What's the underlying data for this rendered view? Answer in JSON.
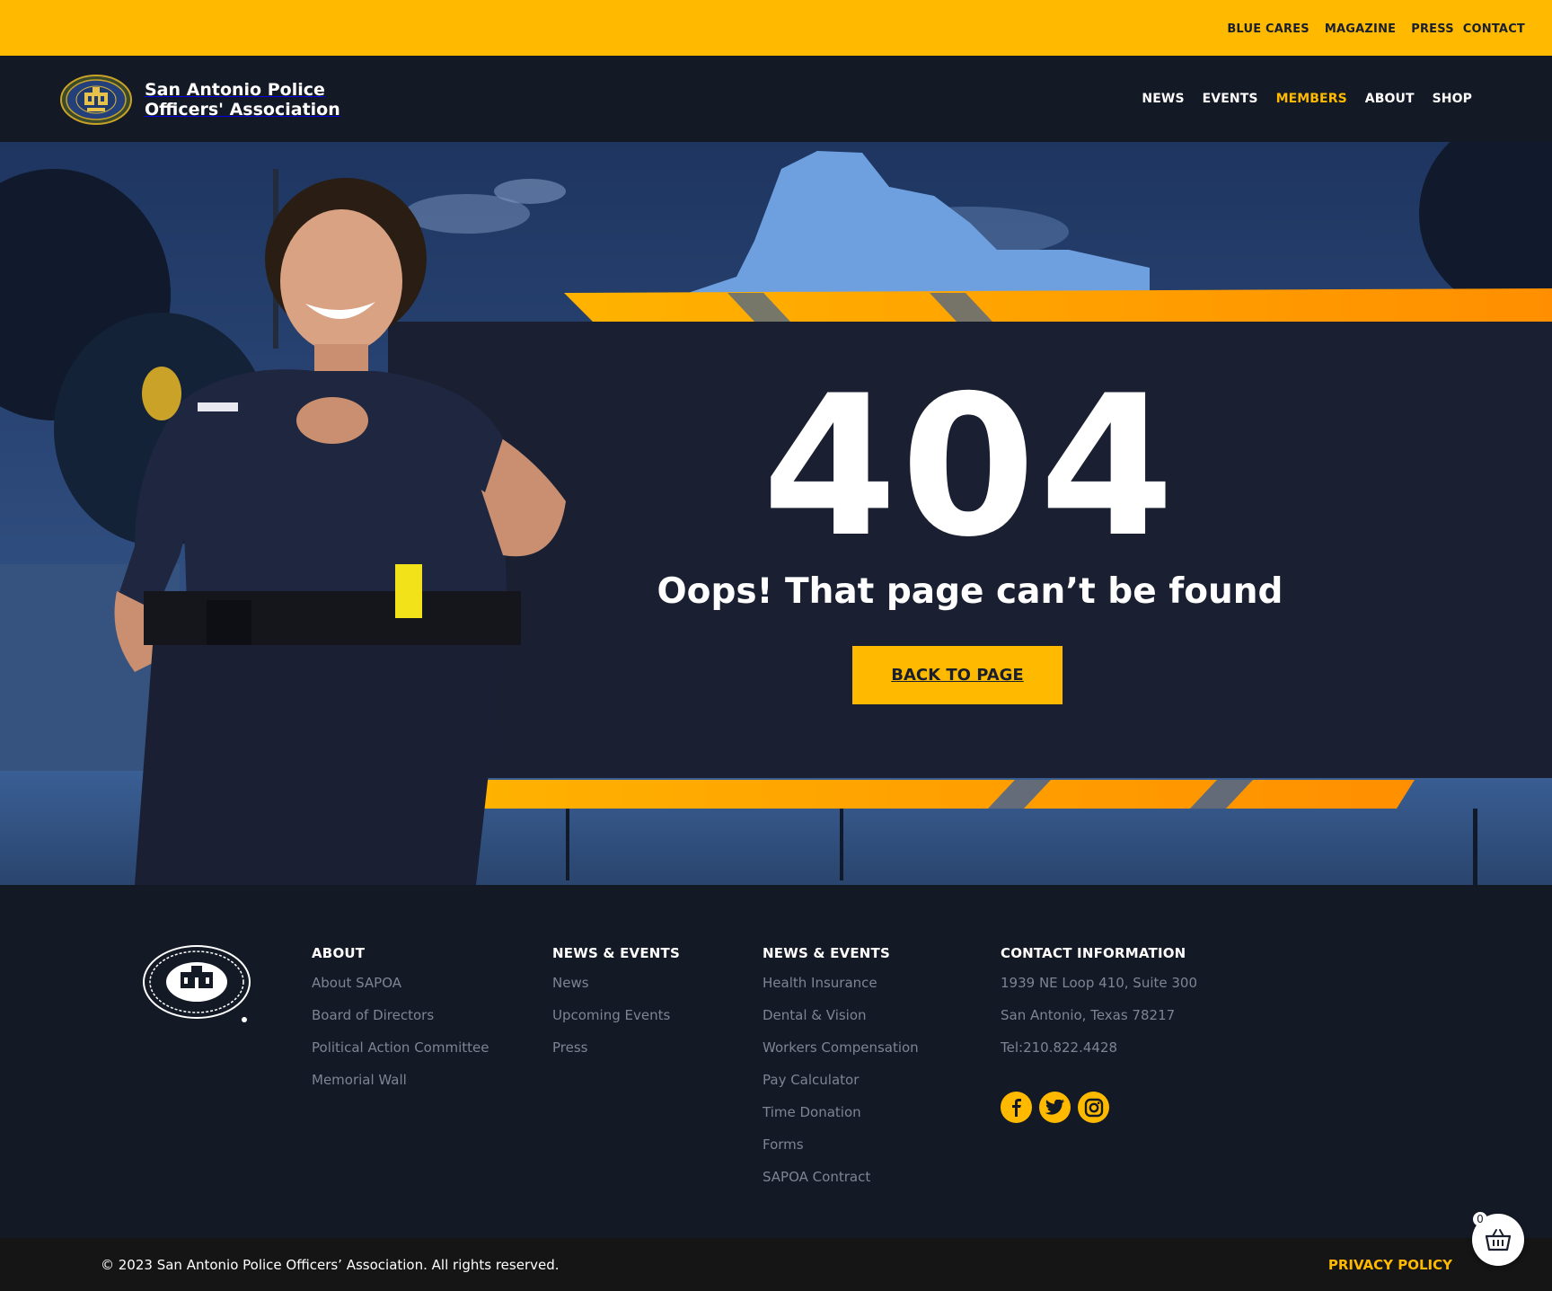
{
  "topbar": {
    "links": [
      "BLUE CARES",
      "MAGAZINE",
      "PRESS",
      "CONTACT"
    ],
    "bg_color": "#ffba00"
  },
  "header": {
    "brand_name_line1": "San Antonio Police",
    "brand_name_line2": "Officers' Association",
    "logo_icon": "badge-seal-icon",
    "nav": [
      "NEWS",
      "EVENTS",
      "MEMBERS",
      "ABOUT",
      "SHOP"
    ],
    "active_nav": "MEMBERS"
  },
  "hero": {
    "code": "404",
    "message": "Oops! That page can’t be found",
    "button_label": "BACK TO PAGE"
  },
  "footer": {
    "logo_icon": "association-seal-icon",
    "columns": [
      {
        "heading": "ABOUT",
        "links": [
          "About SAPOA",
          "Board of Directors",
          "Political Action Committee",
          "Memorial Wall"
        ]
      },
      {
        "heading": "NEWS & EVENTS",
        "links": [
          "News",
          "Upcoming Events",
          "Press"
        ]
      },
      {
        "heading": "NEWS & EVENTS",
        "links": [
          "Health Insurance",
          "Dental & Vision",
          "Workers Compensation",
          "Pay Calculator",
          "Time Donation",
          "Forms",
          "SAPOA Contract"
        ]
      },
      {
        "heading": "CONTACT INFORMATION",
        "lines": [
          "1939 NE Loop 410, Suite 300",
          "San Antonio, Texas 78217",
          "Tel:210.822.4428"
        ]
      }
    ],
    "socials": [
      "facebook-icon",
      "twitter-icon",
      "instagram-icon"
    ]
  },
  "bottombar": {
    "copyright": "© 2023 San Antonio Police Officers’ Association. All rights reserved.",
    "privacy": "PRIVACY POLICY"
  },
  "cart": {
    "count": "0",
    "icon": "basket-icon"
  },
  "colors": {
    "accent": "#ffba00",
    "dark": "#141926",
    "panel": "#1a2032"
  }
}
